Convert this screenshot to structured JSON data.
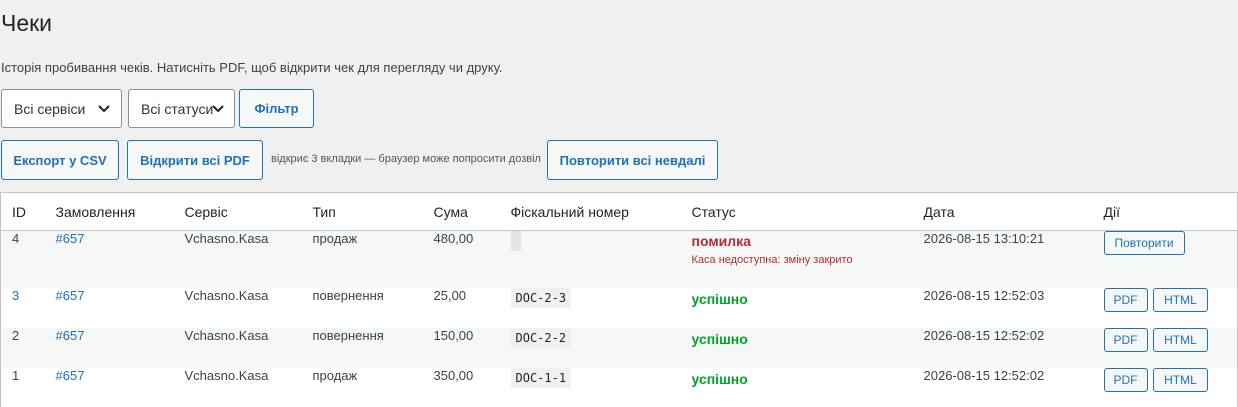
{
  "page": {
    "title": "Чеки",
    "description": "Історія пробивання чеків. Натисніть PDF, щоб відкрити чек для перегляду чи друку."
  },
  "filters": {
    "service_select": "Всі сервіси",
    "status_select": "Всі статуси",
    "filter_button": "Фільтр"
  },
  "actions": {
    "export_csv": "Експорт у CSV",
    "open_all_pdf": "Відкрити всі PDF",
    "open_all_hint": "відкриє 3 вкладки — браузер може попросити дозвіл",
    "retry_all_failed": "Повторити всі невдалі"
  },
  "table": {
    "headers": [
      "ID",
      "Замовлення",
      "Сервіс",
      "Тип",
      "Сума",
      "Фіскальний номер",
      "Статус",
      "Дата",
      "Дії"
    ],
    "rows": [
      {
        "id": "4",
        "order": "#657",
        "service": "Vchasno.Kasa",
        "type": "продаж",
        "sum": "480,00",
        "fiscal": "",
        "status": "помилка",
        "status_detail": "Каса недоступна: зміну закрито",
        "date": "2026-08-15 13:10:21",
        "actions": [
          "Повторити"
        ]
      },
      {
        "id": "3",
        "order": "#657",
        "service": "Vchasno.Kasa",
        "type": "повернення",
        "sum": "25,00",
        "fiscal": "DOC-2-3",
        "status": "успішно",
        "status_detail": "",
        "date": "2026-08-15 12:52:03",
        "actions": [
          "PDF",
          "HTML"
        ]
      },
      {
        "id": "2",
        "order": "#657",
        "service": "Vchasno.Kasa",
        "type": "повернення",
        "sum": "150,00",
        "fiscal": "DOC-2-2",
        "status": "успішно",
        "status_detail": "",
        "date": "2026-08-15 12:52:02",
        "actions": [
          "PDF",
          "HTML"
        ]
      },
      {
        "id": "1",
        "order": "#657",
        "service": "Vchasno.Kasa",
        "type": "продаж",
        "sum": "350,00",
        "fiscal": "DOC-1-1",
        "status": "успішно",
        "status_detail": "",
        "date": "2026-08-15 12:52:02",
        "actions": [
          "PDF",
          "HTML"
        ]
      }
    ]
  },
  "colors": {
    "accent": "#2271b1",
    "error": "#b32d2e",
    "success": "#00a32a",
    "background": "#f0f0f1"
  },
  "icons": {
    "select_arrow": "chevron-down-icon"
  }
}
